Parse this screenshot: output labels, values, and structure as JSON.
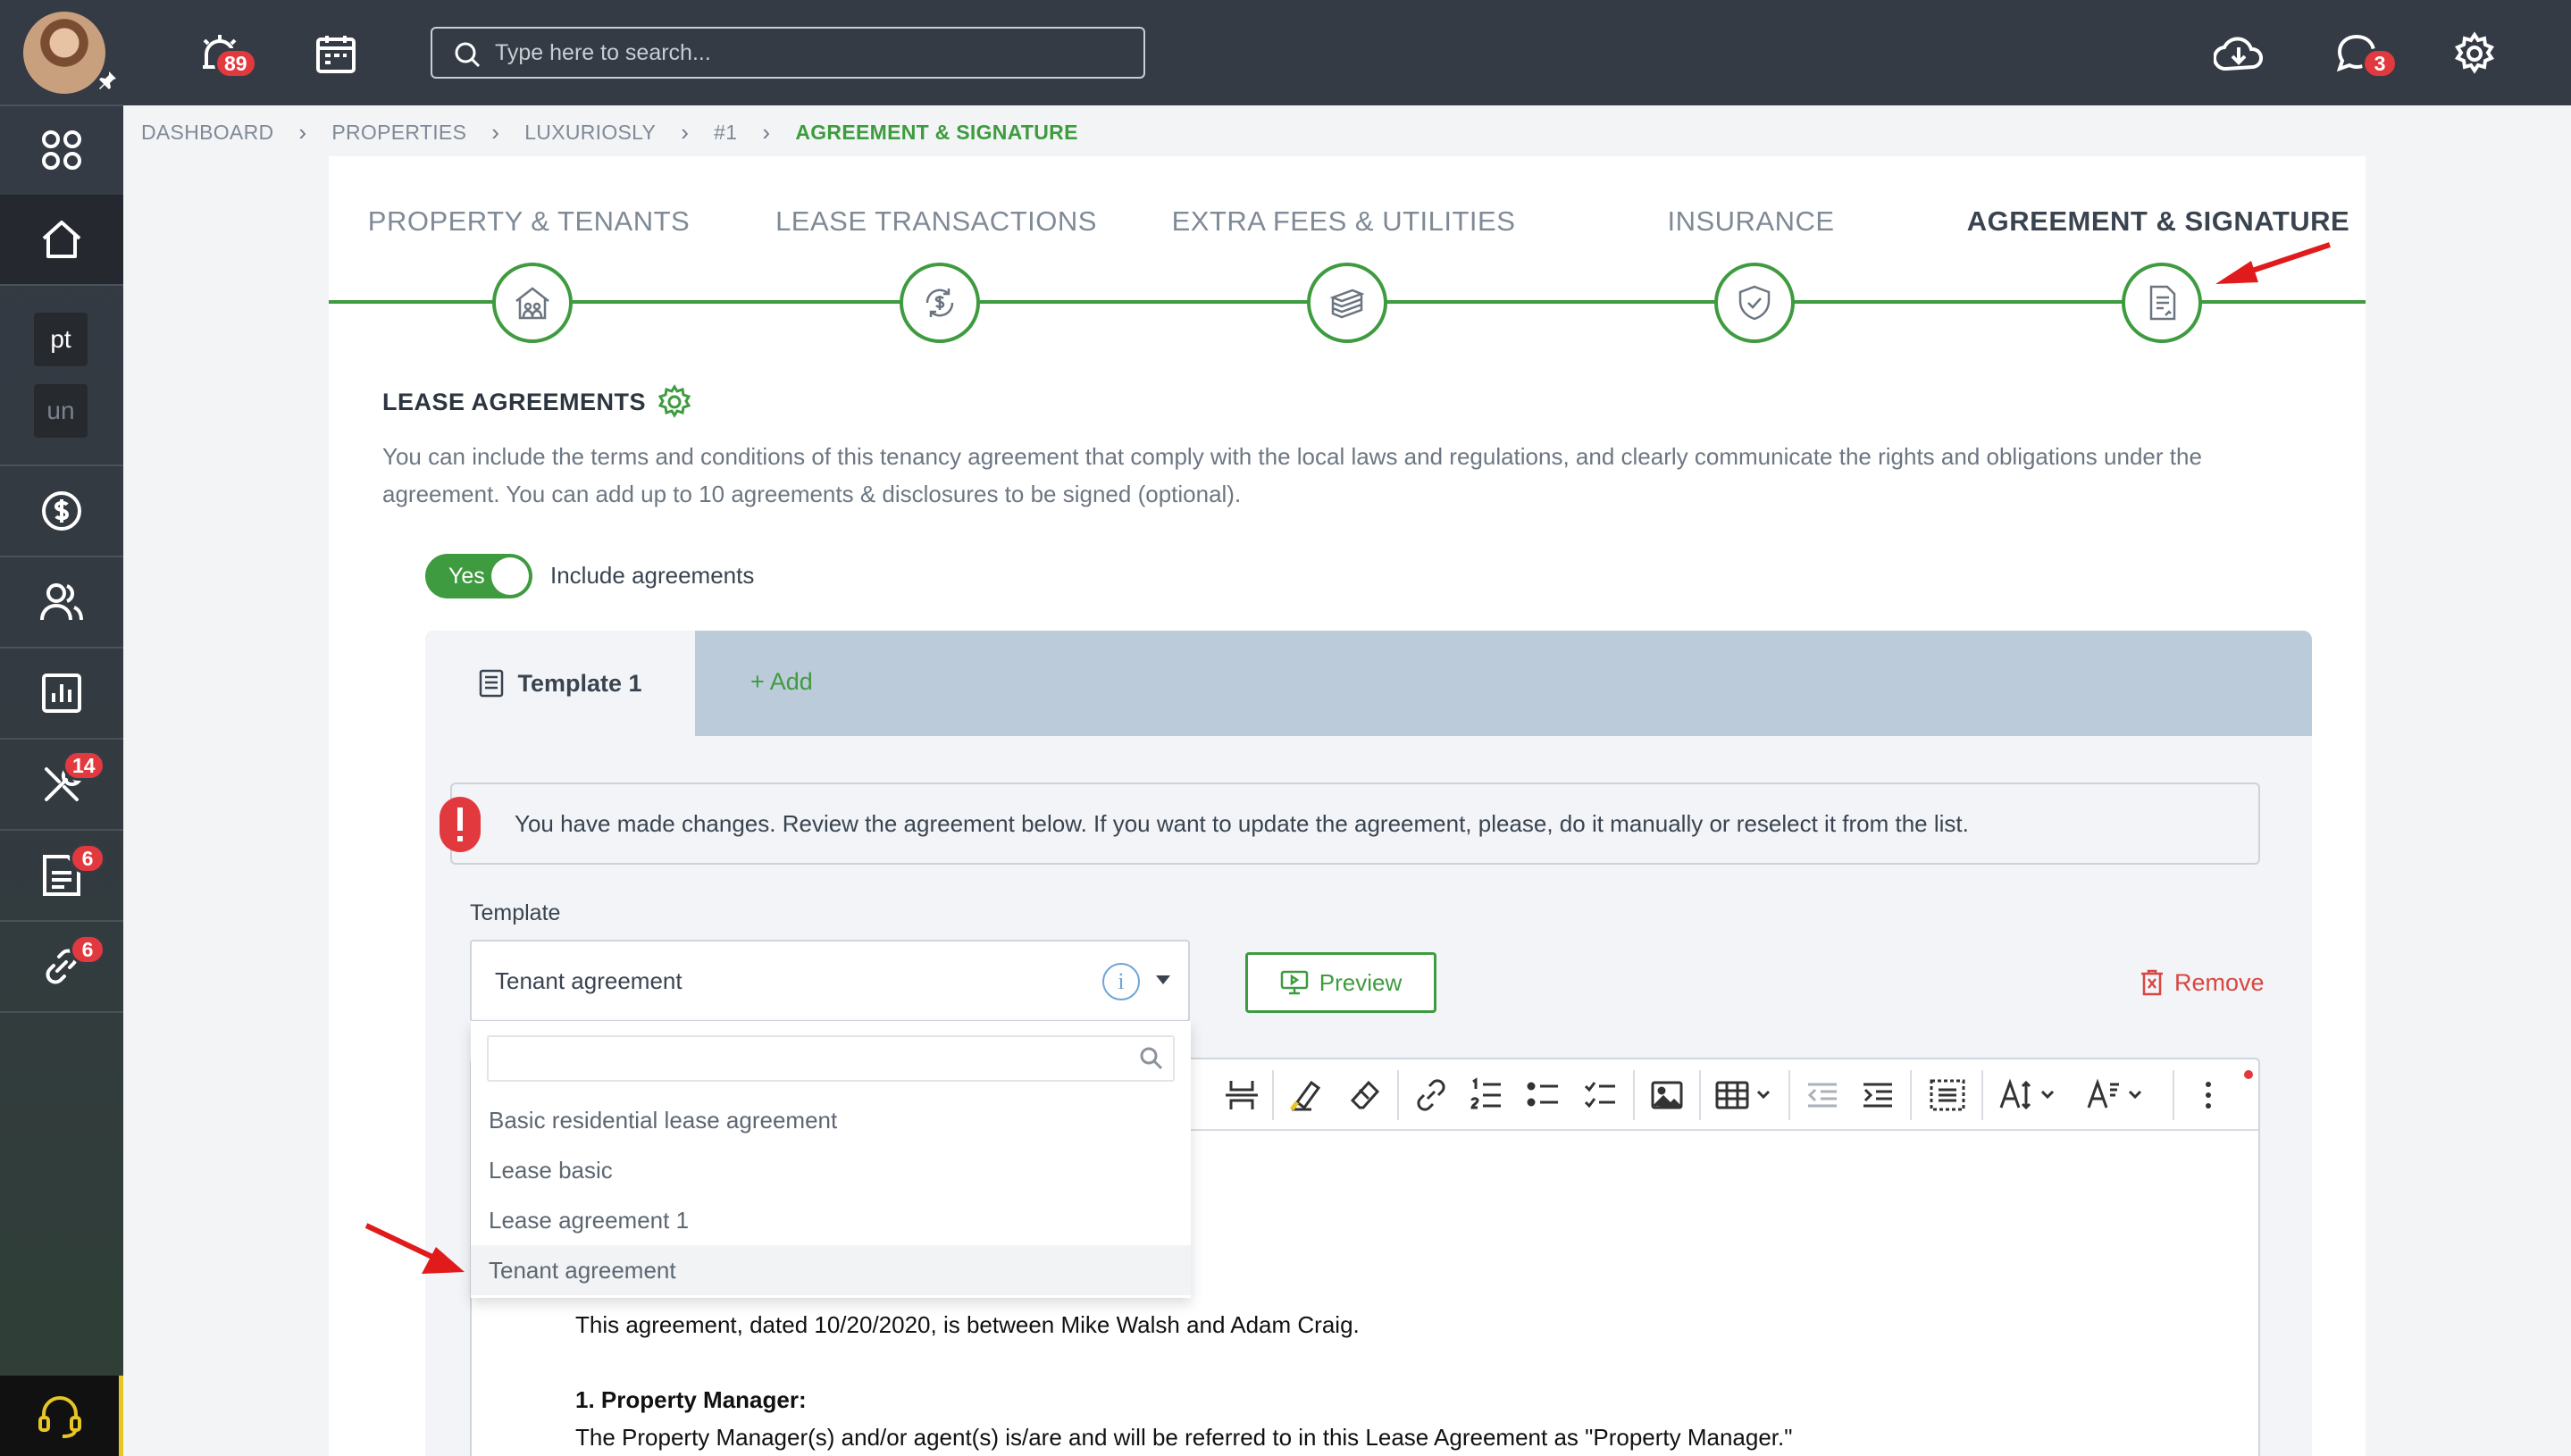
{
  "sidebar": {
    "square_items": [
      "pt",
      "un"
    ],
    "badges": {
      "tools": "14",
      "documents": "6",
      "links": "6"
    }
  },
  "topbar": {
    "notifications_badge": "89",
    "messages_badge": "3",
    "search_placeholder": "Type here to search..."
  },
  "breadcrumb": [
    "DASHBOARD",
    "PROPERTIES",
    "LUXURIOSLY",
    "#1",
    "AGREEMENT & SIGNATURE"
  ],
  "steps": [
    {
      "label": "PROPERTY & TENANTS",
      "icon": "house-people-icon"
    },
    {
      "label": "LEASE TRANSACTIONS",
      "icon": "money-cycle-icon"
    },
    {
      "label": "EXTRA FEES & UTILITIES",
      "icon": "money-stack-icon"
    },
    {
      "label": "INSURANCE",
      "icon": "shield-check-icon"
    },
    {
      "label": "AGREEMENT & SIGNATURE",
      "icon": "document-sign-icon",
      "current": true
    }
  ],
  "section": {
    "title": "LEASE AGREEMENTS",
    "description": "You can include the terms and conditions of this tenancy agreement that comply with the local laws and regulations, and clearly communicate the rights and obligations under the agreement. You can add up to 10 agreements & disclosures to be signed (optional).",
    "toggle_value": "Yes",
    "toggle_label": "Include agreements"
  },
  "tabs": {
    "active": "Template 1",
    "add": "+ Add"
  },
  "alert": "You have made changes. Review the agreement below. If you want to update the agreement, please, do it manually or reselect it from the list.",
  "template_field": {
    "label": "Template",
    "value": "Tenant agreement",
    "options": [
      "Basic residential lease agreement",
      "Lease basic",
      "Lease agreement 1",
      "Tenant agreement"
    ]
  },
  "buttons": {
    "preview": "Preview",
    "remove": "Remove"
  },
  "editor": {
    "line1": "This agreement, dated 10/20/2020, is between Mike Walsh and Adam Craig.",
    "heading1": "1. Property Manager:",
    "line2": "The Property Manager(s) and/or agent(s) is/are and will be referred to in this Lease Agreement as \"Property Manager.\""
  },
  "colors": {
    "accent_green": "#3e9b3f",
    "danger_red": "#d9463f",
    "badge_red": "#e2393f",
    "topbar": "#353b45"
  }
}
